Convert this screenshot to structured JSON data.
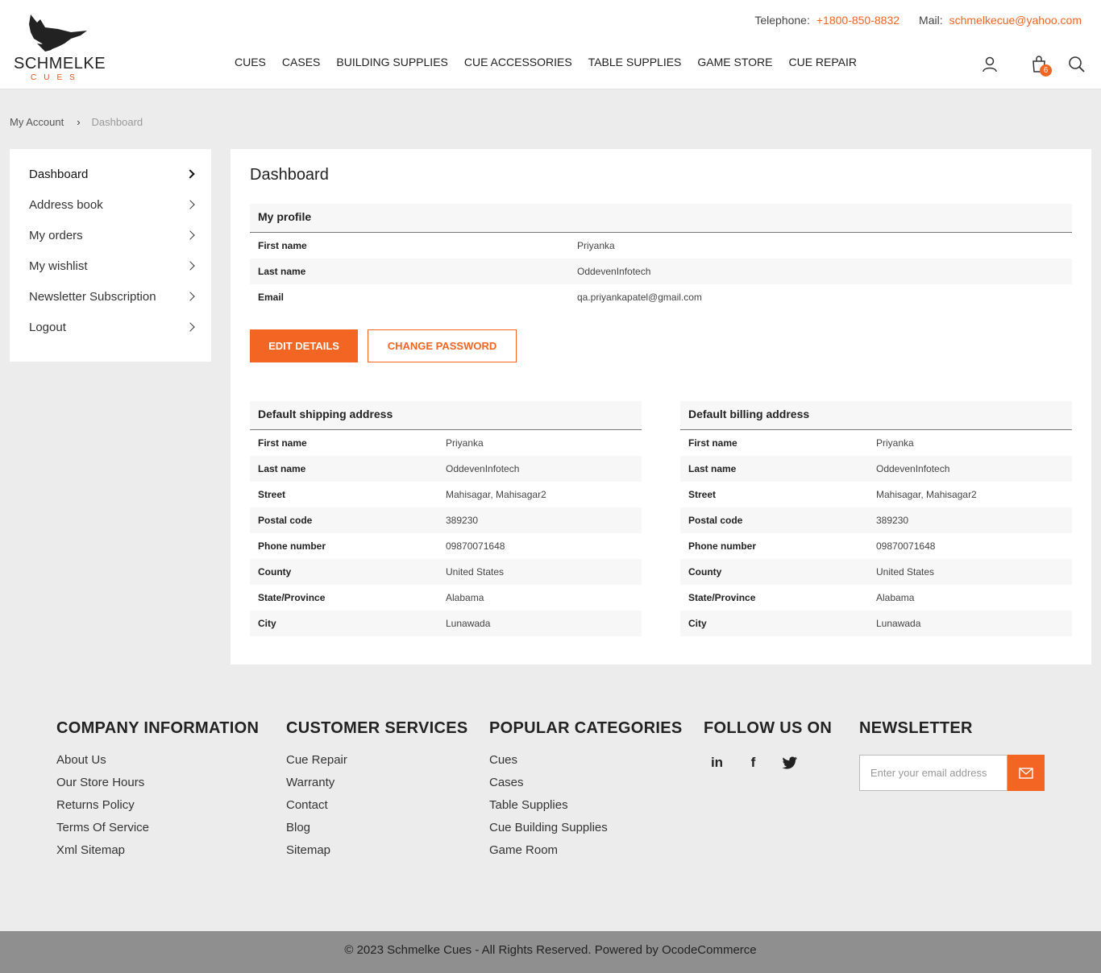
{
  "brand": {
    "name": "SCHMELKE",
    "sub": "CUES"
  },
  "contact": {
    "phone_label": "Telephone:",
    "phone": "+1800-850-8832",
    "mail_label": "Mail:",
    "mail": "schmelkecue@yahoo.com"
  },
  "nav": [
    "CUES",
    "CASES",
    "BUILDING SUPPLIES",
    "CUE ACCESSORIES",
    "TABLE SUPPLIES",
    "GAME STORE",
    "CUE REPAIR"
  ],
  "cart_count": "6",
  "breadcrumb": {
    "parent": "My Account",
    "current": "Dashboard"
  },
  "sidebar": [
    "Dashboard",
    "Address book",
    "My orders",
    "My wishlist",
    "Newsletter Subscription",
    "Logout"
  ],
  "main": {
    "title": "Dashboard",
    "profile": {
      "heading": "My profile",
      "rows": [
        {
          "label": "First name",
          "value": "Priyanka"
        },
        {
          "label": "Last name",
          "value": "OddevenInfotech"
        },
        {
          "label": "Email",
          "value": "qa.priyankapatel@gmail.com"
        }
      ]
    },
    "edit_button": "EDIT DETAILS",
    "password_button": "CHANGE PASSWORD",
    "shipping": {
      "heading": "Default shipping address",
      "rows": [
        {
          "label": "First name",
          "value": "Priyanka"
        },
        {
          "label": "Last name",
          "value": "OddevenInfotech"
        },
        {
          "label": "Street",
          "value": "Mahisagar, Mahisagar2"
        },
        {
          "label": "Postal code",
          "value": "389230"
        },
        {
          "label": "Phone number",
          "value": "09870071648"
        },
        {
          "label": "County",
          "value": "United States"
        },
        {
          "label": "State/Province",
          "value": "Alabama"
        },
        {
          "label": "City",
          "value": "Lunawada"
        }
      ]
    },
    "billing": {
      "heading": "Default billing address",
      "rows": [
        {
          "label": "First name",
          "value": "Priyanka"
        },
        {
          "label": "Last name",
          "value": "OddevenInfotech"
        },
        {
          "label": "Street",
          "value": "Mahisagar, Mahisagar2"
        },
        {
          "label": "Postal code",
          "value": "389230"
        },
        {
          "label": "Phone number",
          "value": "09870071648"
        },
        {
          "label": "County",
          "value": "United States"
        },
        {
          "label": "State/Province",
          "value": "Alabama"
        },
        {
          "label": "City",
          "value": "Lunawada"
        }
      ]
    }
  },
  "footer": {
    "company": {
      "title": "COMPANY INFORMATION",
      "links": [
        "About Us",
        "Our Store Hours",
        "Returns Policy",
        "Terms Of Service",
        "Xml Sitemap"
      ]
    },
    "services": {
      "title": "CUSTOMER SERVICES",
      "links": [
        "Cue Repair",
        "Warranty",
        "Contact",
        "Blog",
        "Sitemap"
      ]
    },
    "categories": {
      "title": "POPULAR CATEGORIES",
      "links": [
        "Cues",
        "Cases",
        "Table Supplies",
        "Cue Building Supplies",
        "Game Room"
      ]
    },
    "follow": {
      "title": "FOLLOW US ON",
      "icons": [
        "linkedin-icon",
        "facebook-icon",
        "twitter-icon"
      ]
    },
    "newsletter": {
      "title": "NEWSLETTER",
      "placeholder": "Enter your email address"
    },
    "copyright": "© 2023 Schmelke Cues - All Rights Reserved. Powered by OcodeCommerce"
  },
  "colors": {
    "accent": "#f26522",
    "background": "#ececec"
  }
}
